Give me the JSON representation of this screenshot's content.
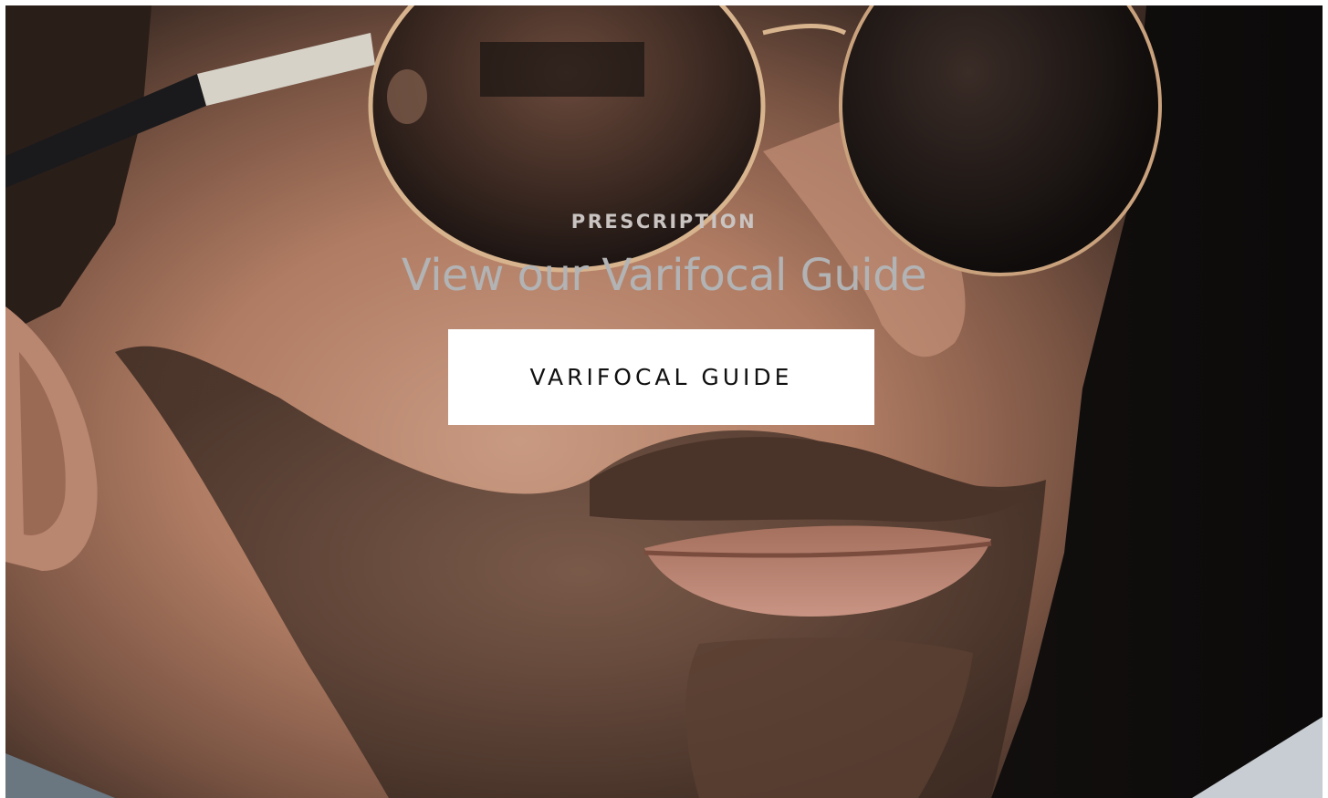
{
  "hero": {
    "eyebrow": "PRESCRIPTION",
    "headline": "View our Varifocal Guide",
    "cta_label": "VARIFOCAL GUIDE"
  },
  "colors": {
    "eyebrow_text": "#c9c4c1",
    "headline_text": "#b2b3b5",
    "button_bg": "#ffffff",
    "button_text": "#111111",
    "background_dark": "#14100f",
    "skin": "#c08a70"
  },
  "image": {
    "subject": "close-up of bearded man wearing round gold aviator sunglasses"
  }
}
